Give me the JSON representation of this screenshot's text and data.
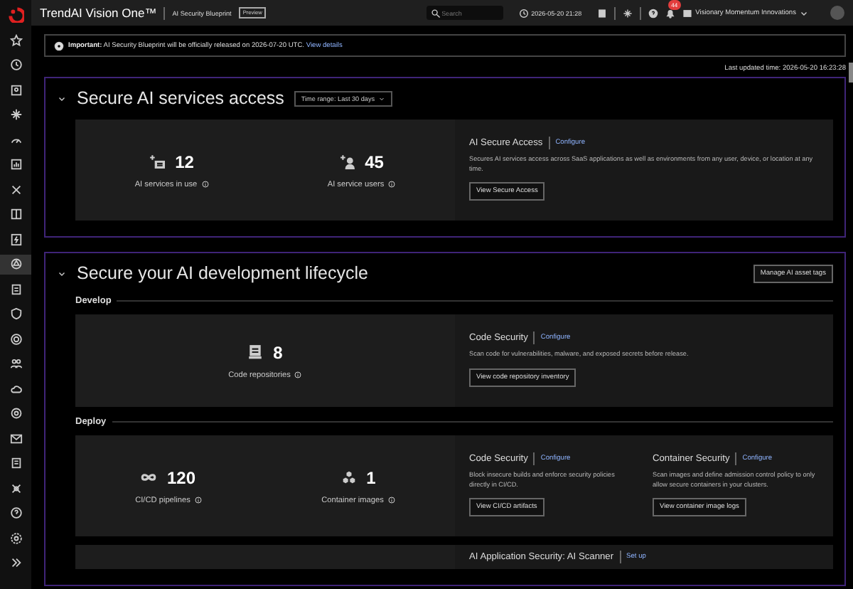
{
  "top_bar": {
    "product": "TrendAI Vision One™",
    "app": "AI Security Blueprint",
    "badge": "Preview",
    "search": {
      "placeholder": "Search"
    },
    "datetime": "2026-05-20 21:28",
    "notifications": "44",
    "organization": "Visionary Momentum Innovations"
  },
  "sidebar": {
    "items": [
      {
        "selected": false
      },
      {
        "selected": false
      },
      {
        "selected": false
      },
      {
        "selected": false
      },
      {
        "selected": false
      },
      {
        "selected": false
      },
      {
        "selected": false
      },
      {
        "selected": false
      },
      {
        "selected": false
      },
      {
        "selected": true
      },
      {
        "selected": false
      },
      {
        "selected": false
      },
      {
        "selected": false
      },
      {
        "selected": false
      },
      {
        "selected": false
      },
      {
        "selected": false
      },
      {
        "selected": false
      },
      {
        "selected": false
      },
      {
        "selected": false
      },
      {
        "selected": false
      },
      {
        "selected": false
      }
    ]
  },
  "banner": {
    "label": "Important:",
    "message": "AI Security Blueprint will be officially released on 2026-07-20 UTC.",
    "link": "View details"
  },
  "last_updated": "Last updated time: 2026-05-20 16:23:28",
  "sections": [
    {
      "title": "Secure AI services access",
      "expanded": true,
      "time_range": {
        "label": "Time range:",
        "value": "Last 30 days"
      },
      "groups": [
        {
          "stats": [
            {
              "kind": "services",
              "value": "12",
              "label": "AI services in use"
            },
            {
              "kind": "users",
              "value": "45",
              "label": "AI service users"
            }
          ],
          "products": [
            {
              "name": "AI Secure Access",
              "link": "Configure",
              "description": "Secures AI services access across SaaS applications as well as environments from any user, device, or location at any time.",
              "button": "View Secure Access"
            }
          ]
        }
      ]
    },
    {
      "title": "Secure your AI development lifecycle",
      "expanded": true,
      "action": "Manage AI asset tags",
      "groups": [
        {
          "title": "Develop",
          "stats": [
            {
              "kind": "repository",
              "value": "8",
              "label": "Code repositories"
            }
          ],
          "products": [
            {
              "name": "Code Security",
              "link": "Configure",
              "description": "Scan code for vulnerabilities, malware, and exposed secrets before release.",
              "button": "View code repository inventory"
            }
          ]
        },
        {
          "title": "Deploy",
          "stats": [
            {
              "kind": "pipeline",
              "value": "120",
              "label": "CI/CD pipelines"
            },
            {
              "kind": "containers",
              "value": "1",
              "label": "Container images"
            }
          ],
          "products": [
            {
              "name": "Code Security",
              "link": "Configure",
              "description": "Block insecure builds and enforce security policies directly in CI/CD.",
              "button": "View CI/CD artifacts"
            },
            {
              "name": "Container Security",
              "link": "Configure",
              "description": "Scan images and define admission control policy to only allow secure containers in your clusters.",
              "button": "View container image logs"
            }
          ]
        },
        {
          "products": [
            {
              "name": "AI Application Security: AI Scanner",
              "link": "Set up"
            }
          ]
        }
      ]
    }
  ]
}
